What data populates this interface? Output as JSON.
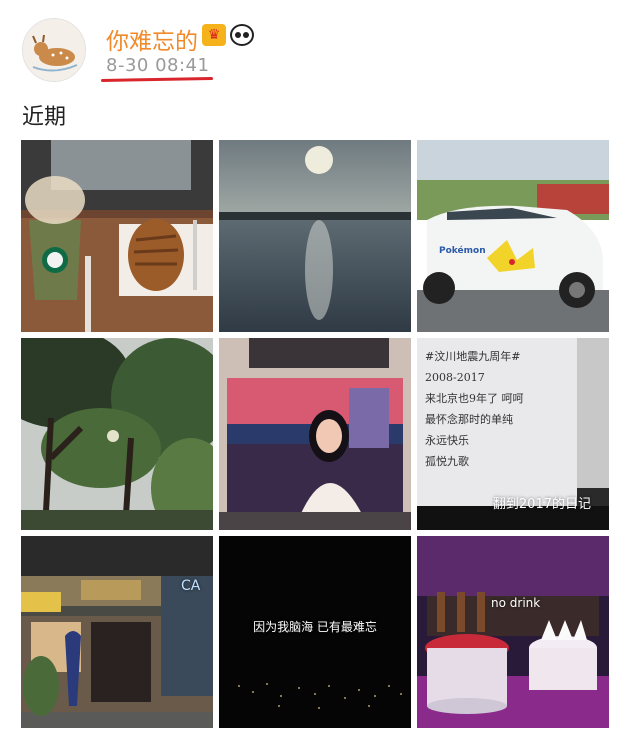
{
  "post": {
    "author": "你难忘的",
    "timestamp": "8-30 08:41",
    "text": "近期",
    "badge_crown_icon": "crown-badge",
    "badge_panda_icon": "panda-badge"
  },
  "photos": {
    "note_caption": "翻到2017的日记",
    "note_handwriting": [
      "#汶川地震九周年#",
      "2008-2017",
      "来北京也9年了 呵呵",
      "最怀念那时的单纯",
      "永远快乐",
      "孤悦九歌"
    ],
    "night_caption": "因为我脑海  已有最难忘",
    "cake_caption": "no drink",
    "car_logo": "Pokémon",
    "storefront_sign": "CA"
  },
  "colors": {
    "author": "#f08a2b",
    "underline": "#d9262c",
    "timestamp": "#9a9a9a"
  }
}
